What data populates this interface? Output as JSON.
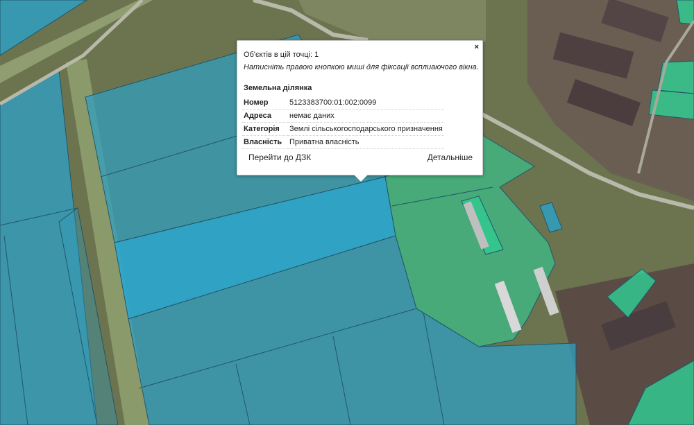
{
  "map": {
    "colors": {
      "parcel_blue": "#2f9fc1",
      "parcel_green": "#2fcf95",
      "parcel_outline": "#22566b",
      "selected_parcel": "#2aa7cf"
    }
  },
  "popup": {
    "close_label": "×",
    "objects_count": "Об'єктів в цій точці: 1",
    "hint": "Натисніть правою кнопкою миші для фіксації всплиаючого вікна.",
    "parcel_title": "Земельна ділянка",
    "properties": [
      {
        "key": "Номер",
        "value": "5123383700:01:002:0099"
      },
      {
        "key": "Адреса",
        "value": "немає даних"
      },
      {
        "key": "Категорія",
        "value": "Землі сільськогосподарського призначення"
      },
      {
        "key": "Власність",
        "value": "Приватна власність"
      }
    ],
    "goto_label": "Перейти до ДЗК",
    "details_label": "Детальніше"
  }
}
